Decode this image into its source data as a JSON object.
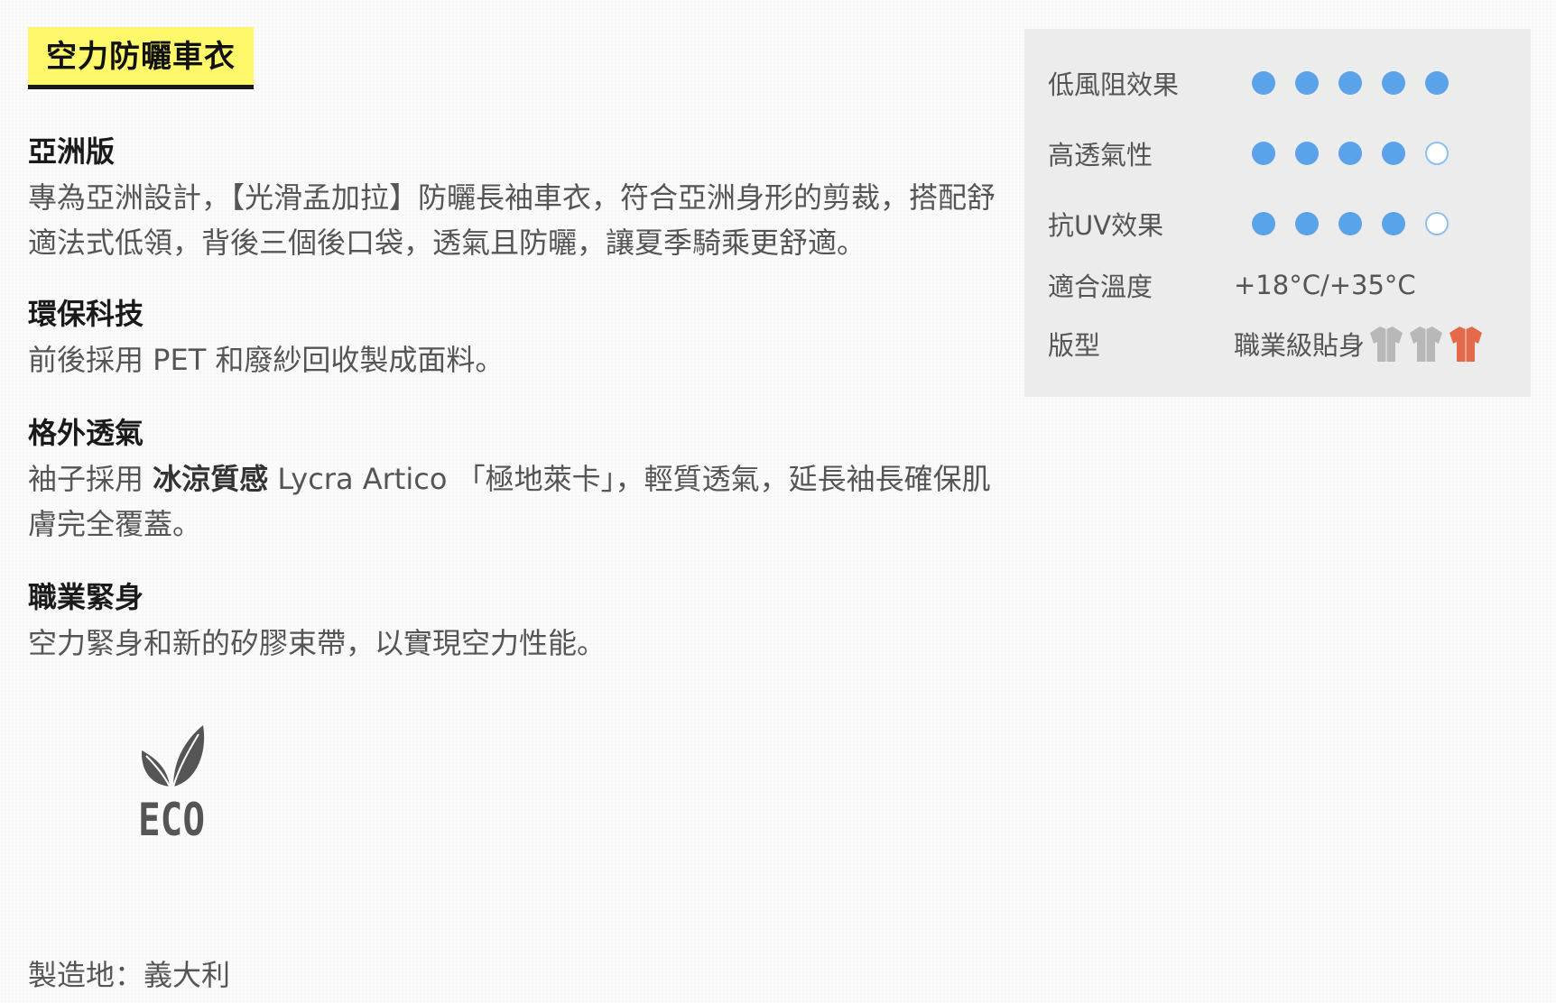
{
  "product": {
    "title": "空力防曬車衣"
  },
  "sections": [
    {
      "heading": "亞洲版",
      "body": "專為亞洲設計，【光滑孟加拉】防曬長袖車衣，符合亞洲身形的剪裁，搭配舒適法式低領，背後三個後口袋，透氣且防曬，讓夏季騎乘更舒適。"
    },
    {
      "heading": "環保科技",
      "body": "前後採用 PET 和廢紗回收製成面料。"
    },
    {
      "heading": "格外透氣",
      "body_prefix": "袖子採用 ",
      "body_strong": "冰涼質感",
      "body_suffix": " Lycra Artico 「極地萊卡」，輕質透氣，延長袖長確保肌膚完全覆蓋。"
    },
    {
      "heading": "職業緊身",
      "body": "空力緊身和新的矽膠束帶，以實現空力性能。"
    }
  ],
  "eco_badge": {
    "label": "ECO",
    "icon": "leaf-icon"
  },
  "origin": "製造地：義大利",
  "specs": {
    "ratings": [
      {
        "label": "低風阻效果",
        "value": 5,
        "max": 5
      },
      {
        "label": "高透氣性",
        "value": 4,
        "max": 5
      },
      {
        "label": "抗UV效果",
        "value": 4,
        "max": 5
      }
    ],
    "temperature": {
      "label": "適合溫度",
      "value": "+18°C/+35°C"
    },
    "fit": {
      "label": "版型",
      "value": "職業級貼身",
      "icons": [
        "jersey-icon",
        "jersey-icon",
        "jersey-icon"
      ],
      "selected_index": 2
    }
  },
  "colors": {
    "title_badge_bg": "#fff86a",
    "dot_filled": "#5aa2ea",
    "dot_empty_border": "#8cc0f2",
    "jersey_inactive": "#b8b8b8",
    "jersey_active": "#e46a4c",
    "panel_bg": "#ececec"
  }
}
